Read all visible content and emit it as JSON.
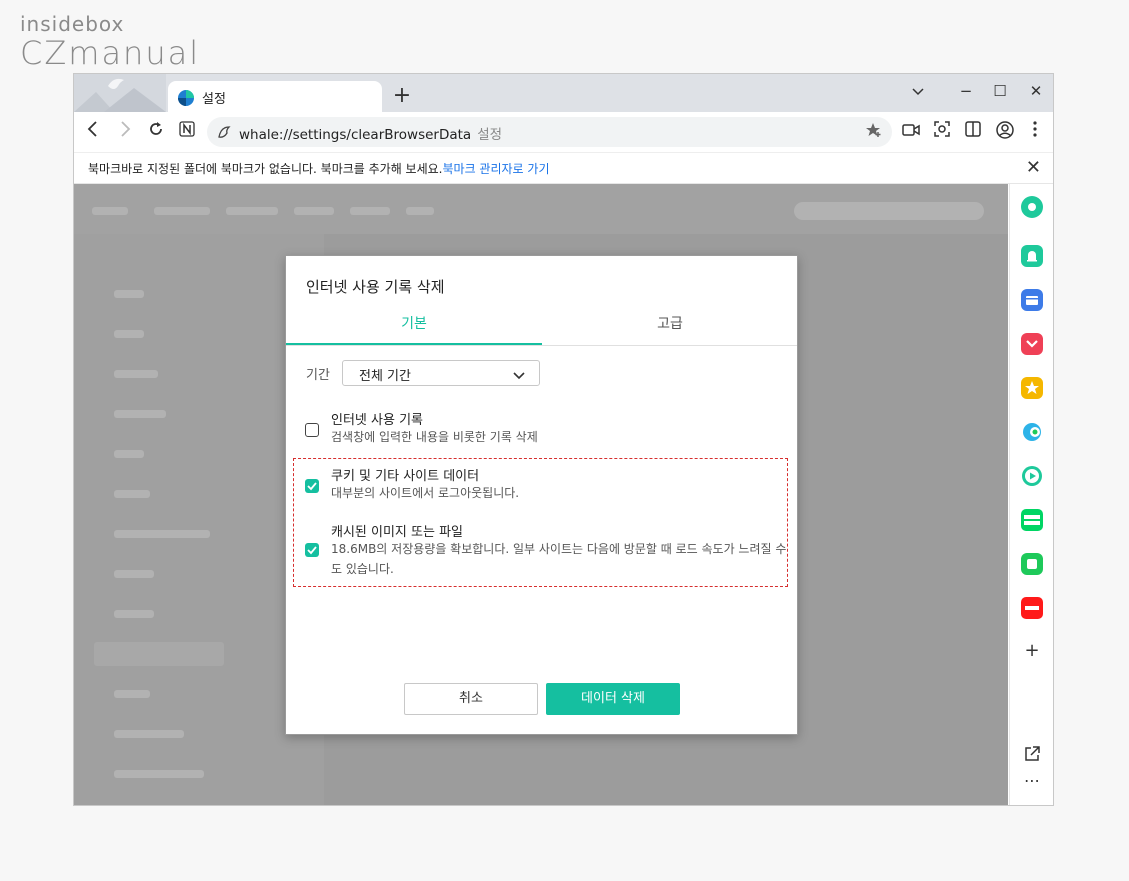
{
  "watermark": {
    "top": "insidebox",
    "bottom": "CZmanual"
  },
  "window": {
    "tab_title": "설정",
    "new_tab": "+",
    "controls": {
      "minimize": "−",
      "maximize": "☐",
      "close": "✕"
    }
  },
  "toolbar": {
    "url": "whale://settings/clearBrowserData",
    "url_suffix": "설정"
  },
  "bookmark_bar": {
    "message": "북마크바로 지정된 폴더에 북마크가 없습니다. 북마크를 추가해 보세요.",
    "link": "북마크 관리자로 가기"
  },
  "dialog": {
    "title": "인터넷 사용 기록 삭제",
    "tabs": [
      {
        "label": "기본",
        "active": true
      },
      {
        "label": "고급",
        "active": false
      }
    ],
    "period_label": "기간",
    "period_value": "전체 기간",
    "options": [
      {
        "title": "인터넷 사용 기록",
        "desc": "검색창에 입력한 내용을 비롯한 기록 삭제",
        "checked": false
      },
      {
        "title": "쿠키 및 기타 사이트 데이터",
        "desc": "대부분의 사이트에서 로그아웃됩니다.",
        "checked": true
      },
      {
        "title": "캐시된 이미지 또는 파일",
        "desc": "18.6MB의 저장용량을 확보합니다. 일부 사이트는 다음에 방문할 때 로드 속도가 느려질 수도 있습니다.",
        "checked": true
      }
    ],
    "cancel_label": "취소",
    "delete_label": "데이터 삭제"
  },
  "sidebar": {
    "items": [
      {
        "icon": "green-circle-icon",
        "color": "#1ec99b"
      },
      {
        "icon": "alarm-icon",
        "color": "#1ec99b"
      },
      {
        "icon": "wallet-icon",
        "color": "#3d7be8"
      },
      {
        "icon": "pocket-icon",
        "color": "#ef4056"
      },
      {
        "icon": "star-icon",
        "color": "#f5b700"
      },
      {
        "icon": "papago-icon",
        "color": "#2db3e8"
      },
      {
        "icon": "play-icon",
        "color": "#1ec99b"
      },
      {
        "icon": "webtoon-icon",
        "color": "#00d564"
      },
      {
        "icon": "square-icon",
        "color": "#1ec95a"
      },
      {
        "icon": "now-icon",
        "color": "#ff1a1a"
      }
    ],
    "add": "+",
    "more": "⋯"
  },
  "colors": {
    "accent": "#15bfa0",
    "highlight": "#d62e2e",
    "link": "#1a73e8"
  }
}
